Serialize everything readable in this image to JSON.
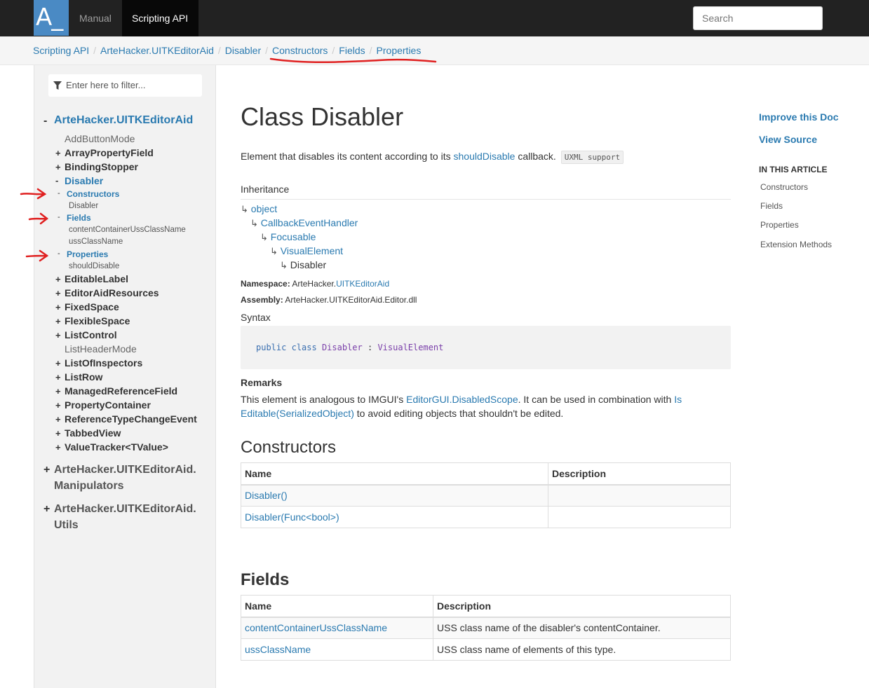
{
  "topbar": {
    "logo": "A_",
    "nav": [
      "Manual",
      "Scripting API"
    ],
    "search_placeholder": "Search"
  },
  "breadcrumb": [
    "Scripting API",
    "ArteHacker.UITKEditorAid",
    "Disabler",
    "Constructors",
    "Fields",
    "Properties"
  ],
  "sidebar": {
    "filter_placeholder": "Enter here to filter...",
    "namespace": "ArteHacker.UITKEditorAid",
    "namespace_toggle": "-",
    "classes_before": [
      {
        "toggle": "",
        "label": "AddButtonMode"
      },
      {
        "toggle": "+",
        "label": "ArrayPropertyField"
      },
      {
        "toggle": "+",
        "label": "BindingStopper"
      }
    ],
    "active_class": {
      "toggle": "-",
      "label": "Disabler"
    },
    "groups": [
      {
        "toggle": "-",
        "label": "Constructors",
        "items": [
          "Disabler"
        ]
      },
      {
        "toggle": "-",
        "label": "Fields",
        "items": [
          "contentContainerUssClassName",
          "ussClassName"
        ]
      },
      {
        "toggle": "-",
        "label": "Properties",
        "items": [
          "shouldDisable"
        ]
      }
    ],
    "classes_after": [
      {
        "toggle": "+",
        "label": "EditableLabel"
      },
      {
        "toggle": "+",
        "label": "EditorAidResources"
      },
      {
        "toggle": "+",
        "label": "FixedSpace"
      },
      {
        "toggle": "+",
        "label": "FlexibleSpace"
      },
      {
        "toggle": "+",
        "label": "ListControl"
      },
      {
        "toggle": "",
        "label": "ListHeaderMode"
      },
      {
        "toggle": "+",
        "label": "ListOfInspectors"
      },
      {
        "toggle": "+",
        "label": "ListRow"
      },
      {
        "toggle": "+",
        "label": "ManagedReferenceField"
      },
      {
        "toggle": "+",
        "label": "PropertyContainer"
      },
      {
        "toggle": "+",
        "label": "ReferenceTypeChangeEvent"
      },
      {
        "toggle": "+",
        "label": "TabbedView"
      },
      {
        "toggle": "+",
        "label": "ValueTracker<TValue>"
      }
    ],
    "other_namespaces": [
      {
        "toggle": "+",
        "line1": "ArteHacker.UITKEditorAid.",
        "line2": "Manipulators"
      },
      {
        "toggle": "+",
        "line1": "ArteHacker.UITKEditorAid.",
        "line2": "Utils"
      }
    ]
  },
  "article": {
    "title": "Class Disabler",
    "summary_pre": "Element that disables its content according to its ",
    "summary_link": "shouldDisable",
    "summary_post": " callback.",
    "summary_badge": "UXML support",
    "inheritance_label": "Inheritance",
    "inheritance": [
      "object",
      "CallbackEventHandler",
      "Focusable",
      "VisualElement",
      "Disabler"
    ],
    "hook": "↳",
    "namespace_label": "Namespace:",
    "namespace_prefix": "ArteHacker.",
    "namespace_link": "UITKEditorAid",
    "assembly_label": "Assembly:",
    "assembly": "ArteHacker.UITKEditorAid.Editor.dll",
    "syntax_label": "Syntax",
    "syntax": {
      "kw1": "public",
      "kw2": "class",
      "name": "Disabler",
      "colon": ":",
      "base": "VisualElement"
    },
    "remarks_label": "Remarks",
    "remarks_pre": "This element is analogous to IMGUI's ",
    "remarks_link1": "EditorGUI.DisabledScope",
    "remarks_mid": ". It can be used in combination with ",
    "remarks_link2a": "Is",
    "remarks_link2b": "Editable(SerializedObject)",
    "remarks_post": " to avoid editing objects that shouldn't be edited.",
    "constructors_heading": "Constructors",
    "constructors_columns": [
      "Name",
      "Description"
    ],
    "constructors": [
      {
        "name": "Disabler()",
        "description": ""
      },
      {
        "name": "Disabler(Func<bool>)",
        "description": ""
      }
    ],
    "fields_heading": "Fields",
    "fields_columns": [
      "Name",
      "Description"
    ],
    "fields": [
      {
        "name": "contentContainerUssClassName",
        "description": "USS class name of the disabler's contentContainer."
      },
      {
        "name": "ussClassName",
        "description": "USS class name of elements of this type."
      }
    ]
  },
  "aside": {
    "improve": "Improve this Doc",
    "view_source": "View Source",
    "in_this_article": "IN THIS ARTICLE",
    "links": [
      "Constructors",
      "Fields",
      "Properties",
      "Extension Methods"
    ]
  },
  "colors": {
    "accent": "#2a7ab0",
    "annotation": "#e02020",
    "topbar": "#222222",
    "logo": "#4a8ac4"
  }
}
